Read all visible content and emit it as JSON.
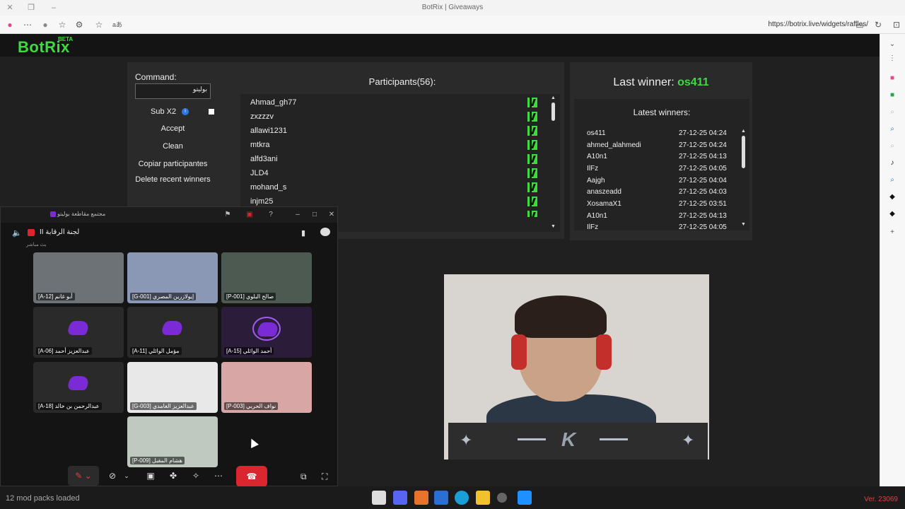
{
  "browser": {
    "tab_title": "BotRix | Giveaways",
    "url": "https://botrix.live/widgets/raffles/",
    "aa_label": "aあ"
  },
  "site": {
    "logo": "BotRix",
    "logo_badge": "BETA"
  },
  "command": {
    "label": "Command:",
    "value": "بوليتو",
    "sub_label": "Sub X2",
    "sub_checked": false,
    "buttons": {
      "accept": "Accept",
      "clean": "Clean",
      "copy": "Copiar participantes",
      "delete": "Delete recent winners"
    }
  },
  "participants": {
    "title": "Participants(56):",
    "names": [
      "Ahmad_gh77",
      "zxzzzv",
      "allawi1231",
      "mtkra",
      "alfd3ani",
      "JLD4",
      "mohand_s",
      "injm25"
    ]
  },
  "winners": {
    "last_label": "Last winner: ",
    "last_name": "os411",
    "latest_title": "Latest winners:",
    "rows": [
      {
        "name": "os411",
        "time": "27-12-25 04:24"
      },
      {
        "name": "ahmed_alahmedi",
        "time": "27-12-25 04:24"
      },
      {
        "name": "A10n1",
        "time": "27-12-25 04:13"
      },
      {
        "name": "IlFz",
        "time": "27-12-25 04:05"
      },
      {
        "name": "Aajgh",
        "time": "27-12-25 04:04"
      },
      {
        "name": "anaszeadd",
        "time": "27-12-25 04:03"
      },
      {
        "name": "XosamaX1",
        "time": "27-12-25 03:51"
      },
      {
        "name": "A10n1",
        "time": "27-12-25 04:13"
      },
      {
        "name": "IlFz",
        "time": "27-12-25 04:05"
      }
    ]
  },
  "meeting": {
    "window_title": "مجتمع مقاطعة بوليتو",
    "channel": "لجنة الرقابة II",
    "subtitle": "بث مباشر",
    "tiles": [
      {
        "label": "أبو غانم [A-12]"
      },
      {
        "label": "إيولازرين المصري [G-001]"
      },
      {
        "label": "صالح البلوي [P-001]"
      },
      {
        "label": "عبدالعزيز أحمد [A-06]"
      },
      {
        "label": "مؤمل الوائلي [A-11]"
      },
      {
        "label": "أحمد الوائلي [A-15]"
      },
      {
        "label": "عبدالرحمن بن خالد [A-18]"
      },
      {
        "label": "عبدالعزيز الغامدي [G-003]"
      },
      {
        "label": "نواف الحربي [P-003]"
      },
      {
        "label": "هشام المقبل [P-009]"
      }
    ]
  },
  "cam": {
    "logo": "K"
  },
  "taskbar": {
    "status": "12 mod packs loaded",
    "version": "Ver. 23069"
  },
  "colors": {
    "accent": "#3ddc3d",
    "hangup": "#d9262f",
    "version": "#e04040"
  }
}
